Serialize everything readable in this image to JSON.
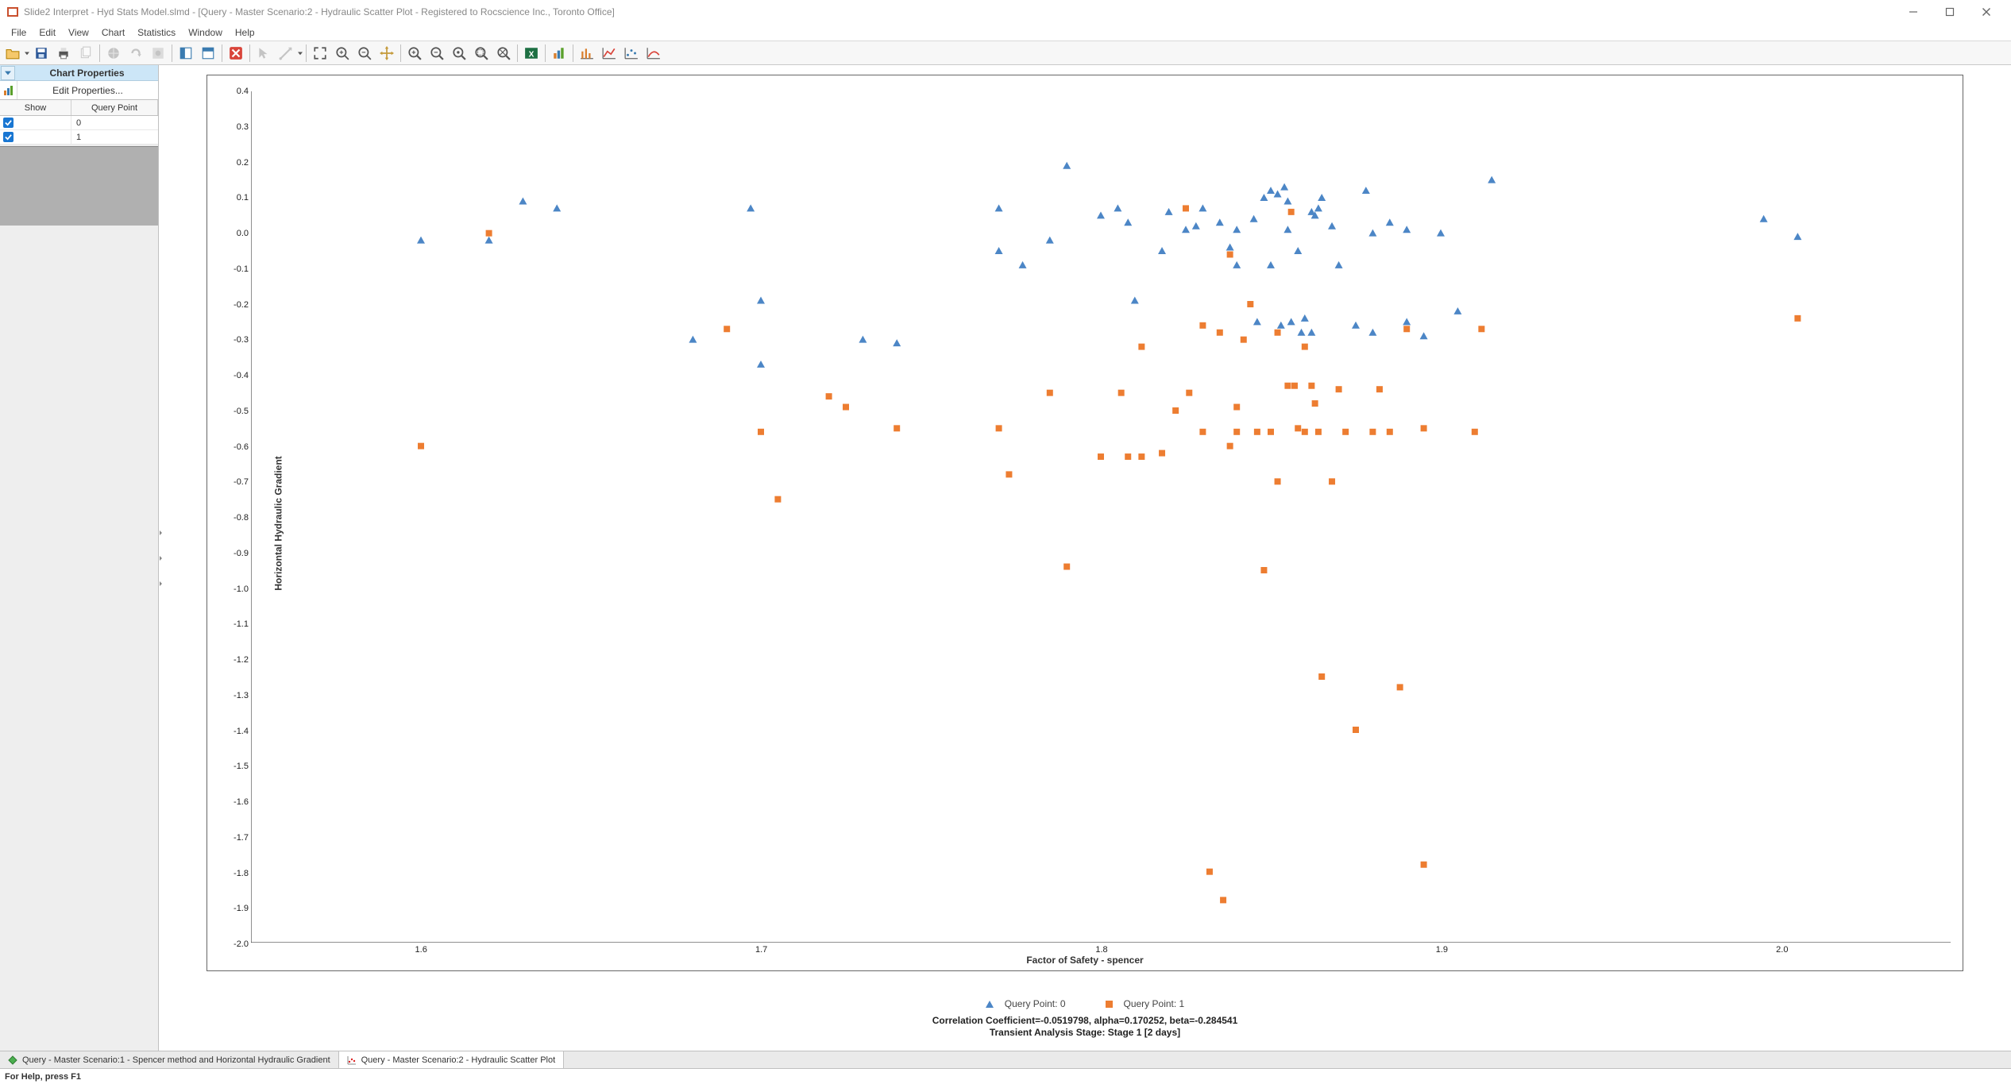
{
  "title": "Slide2 Interpret - Hyd Stats Model.slmd - [Query - Master Scenario:2 - Hydraulic Scatter Plot - Registered to Rocscience Inc., Toronto Office]",
  "menu": [
    "File",
    "Edit",
    "View",
    "Chart",
    "Statistics",
    "Window",
    "Help"
  ],
  "toolbar_icons": [
    "open-folder-icon",
    "dropdown-caret",
    "save-icon",
    "print-icon",
    "copy-icon",
    "sep",
    "globe-icon",
    "redo-icon",
    "compute-icon",
    "sep",
    "panel-left-icon",
    "panel-split-icon",
    "sep",
    "close-x-icon",
    "sep",
    "pointer-icon",
    "line-icon",
    "dropdown-caret",
    "sep",
    "zoom-fit-icon",
    "zoom-in-icon",
    "zoom-out-icon",
    "pan-icon",
    "sep",
    "magnify-plus-icon",
    "magnify-minus-icon",
    "magnify-reset-icon",
    "magnify-region-icon",
    "magnify-all-icon",
    "sep",
    "excel-icon",
    "sep",
    "chart-bar-icon",
    "sep",
    "chart-columns-icon",
    "chart-line-icon",
    "chart-scatter-icon",
    "chart-trend-icon"
  ],
  "sidebar": {
    "header": "Chart Properties",
    "edit_props": "Edit Properties...",
    "columns": {
      "show": "Show",
      "qp": "Query Point"
    },
    "rows": [
      {
        "checked": true,
        "label": "0"
      },
      {
        "checked": true,
        "label": "1"
      }
    ]
  },
  "chart_data": {
    "type": "scatter",
    "xlabel": "Factor of Safety - spencer",
    "ylabel": "Horizontal Hydraulic Gradient",
    "xlim": [
      1.55,
      2.05
    ],
    "ylim": [
      -2.0,
      0.4
    ],
    "xticks": [
      1.6,
      1.7,
      1.8,
      1.9,
      2.0
    ],
    "yticks": [
      0.4,
      0.3,
      0.2,
      0.1,
      0.0,
      -0.1,
      -0.2,
      -0.3,
      -0.4,
      -0.5,
      -0.6,
      -0.7,
      -0.8,
      -0.9,
      -1.0,
      -1.1,
      -1.2,
      -1.3,
      -1.4,
      -1.5,
      -1.6,
      -1.7,
      -1.8,
      -1.9,
      -2.0
    ],
    "series": [
      {
        "name": "Query Point: 0",
        "marker": "triangle",
        "color": "#4c86c6",
        "points": [
          [
            1.6,
            -0.02
          ],
          [
            1.62,
            -0.02
          ],
          [
            1.63,
            0.09
          ],
          [
            1.64,
            0.07
          ],
          [
            1.68,
            -0.3
          ],
          [
            1.697,
            0.07
          ],
          [
            1.7,
            -0.19
          ],
          [
            1.7,
            -0.37
          ],
          [
            1.73,
            -0.3
          ],
          [
            1.74,
            -0.31
          ],
          [
            1.77,
            0.07
          ],
          [
            1.77,
            -0.05
          ],
          [
            1.777,
            -0.09
          ],
          [
            1.785,
            -0.02
          ],
          [
            1.79,
            0.19
          ],
          [
            1.8,
            0.05
          ],
          [
            1.805,
            0.07
          ],
          [
            1.808,
            0.03
          ],
          [
            1.81,
            -0.19
          ],
          [
            1.818,
            -0.05
          ],
          [
            1.82,
            0.06
          ],
          [
            1.825,
            0.01
          ],
          [
            1.828,
            0.02
          ],
          [
            1.83,
            0.07
          ],
          [
            1.835,
            0.03
          ],
          [
            1.838,
            -0.04
          ],
          [
            1.84,
            0.01
          ],
          [
            1.84,
            -0.09
          ],
          [
            1.845,
            0.04
          ],
          [
            1.846,
            -0.25
          ],
          [
            1.848,
            0.1
          ],
          [
            1.85,
            0.12
          ],
          [
            1.85,
            -0.09
          ],
          [
            1.852,
            0.11
          ],
          [
            1.853,
            -0.26
          ],
          [
            1.854,
            0.13
          ],
          [
            1.855,
            0.09
          ],
          [
            1.855,
            0.01
          ],
          [
            1.856,
            -0.25
          ],
          [
            1.858,
            -0.05
          ],
          [
            1.859,
            -0.28
          ],
          [
            1.86,
            -0.24
          ],
          [
            1.862,
            0.06
          ],
          [
            1.862,
            -0.28
          ],
          [
            1.863,
            0.05
          ],
          [
            1.864,
            0.07
          ],
          [
            1.865,
            0.1
          ],
          [
            1.868,
            0.02
          ],
          [
            1.87,
            -0.09
          ],
          [
            1.875,
            -0.26
          ],
          [
            1.878,
            0.12
          ],
          [
            1.88,
            0.0
          ],
          [
            1.88,
            -0.28
          ],
          [
            1.885,
            0.03
          ],
          [
            1.89,
            0.01
          ],
          [
            1.89,
            -0.25
          ],
          [
            1.895,
            -0.29
          ],
          [
            1.9,
            0.0
          ],
          [
            1.905,
            -0.22
          ],
          [
            1.915,
            0.15
          ],
          [
            1.995,
            0.04
          ],
          [
            2.005,
            -0.01
          ]
        ]
      },
      {
        "name": "Query Point: 1",
        "marker": "square",
        "color": "#ed7d31",
        "points": [
          [
            1.6,
            -0.6
          ],
          [
            1.62,
            0.0
          ],
          [
            1.69,
            -0.27
          ],
          [
            1.7,
            -0.56
          ],
          [
            1.705,
            -0.75
          ],
          [
            1.72,
            -0.46
          ],
          [
            1.725,
            -0.49
          ],
          [
            1.74,
            -0.55
          ],
          [
            1.77,
            -0.55
          ],
          [
            1.773,
            -0.68
          ],
          [
            1.785,
            -0.45
          ],
          [
            1.79,
            -0.94
          ],
          [
            1.8,
            -0.63
          ],
          [
            1.806,
            -0.45
          ],
          [
            1.808,
            -0.63
          ],
          [
            1.812,
            -0.32
          ],
          [
            1.812,
            -0.63
          ],
          [
            1.818,
            -0.62
          ],
          [
            1.822,
            -0.5
          ],
          [
            1.825,
            0.07
          ],
          [
            1.826,
            -0.45
          ],
          [
            1.83,
            -0.26
          ],
          [
            1.83,
            -0.56
          ],
          [
            1.832,
            -1.8
          ],
          [
            1.835,
            -0.28
          ],
          [
            1.836,
            -1.88
          ],
          [
            1.838,
            -0.06
          ],
          [
            1.838,
            -0.6
          ],
          [
            1.84,
            -0.56
          ],
          [
            1.84,
            -0.49
          ],
          [
            1.842,
            -0.3
          ],
          [
            1.844,
            -0.2
          ],
          [
            1.846,
            -0.56
          ],
          [
            1.848,
            -0.95
          ],
          [
            1.85,
            -0.56
          ],
          [
            1.852,
            -0.28
          ],
          [
            1.852,
            -0.7
          ],
          [
            1.855,
            -0.43
          ],
          [
            1.856,
            0.06
          ],
          [
            1.857,
            -0.43
          ],
          [
            1.858,
            -0.55
          ],
          [
            1.86,
            -0.32
          ],
          [
            1.86,
            -0.56
          ],
          [
            1.862,
            -0.43
          ],
          [
            1.863,
            -0.48
          ],
          [
            1.864,
            -0.56
          ],
          [
            1.865,
            -1.25
          ],
          [
            1.868,
            -0.7
          ],
          [
            1.87,
            -0.44
          ],
          [
            1.872,
            -0.56
          ],
          [
            1.875,
            -1.4
          ],
          [
            1.88,
            -0.56
          ],
          [
            1.882,
            -0.44
          ],
          [
            1.885,
            -0.56
          ],
          [
            1.888,
            -1.28
          ],
          [
            1.89,
            -0.27
          ],
          [
            1.895,
            -0.55
          ],
          [
            1.895,
            -1.78
          ],
          [
            1.91,
            -0.56
          ],
          [
            1.912,
            -0.27
          ],
          [
            2.005,
            -0.24
          ]
        ]
      }
    ],
    "legend": [
      {
        "marker": "triangle",
        "label": "Query Point: 0"
      },
      {
        "marker": "square",
        "label": "Query Point: 1"
      }
    ],
    "stats_line1": "Correlation Coefficient=-0.0519798, alpha=0.170252, beta=-0.284541",
    "stats_line2": "Transient Analysis Stage: Stage 1 [2 days]"
  },
  "doc_tabs": [
    {
      "icon": "diamond",
      "label": "Query - Master Scenario:1 - Spencer method and Horizontal Hydraulic Gradient",
      "active": false
    },
    {
      "icon": "scatter",
      "label": "Query - Master Scenario:2 - Hydraulic Scatter Plot",
      "active": true
    }
  ],
  "statusbar": {
    "help": "For Help, press F1"
  }
}
